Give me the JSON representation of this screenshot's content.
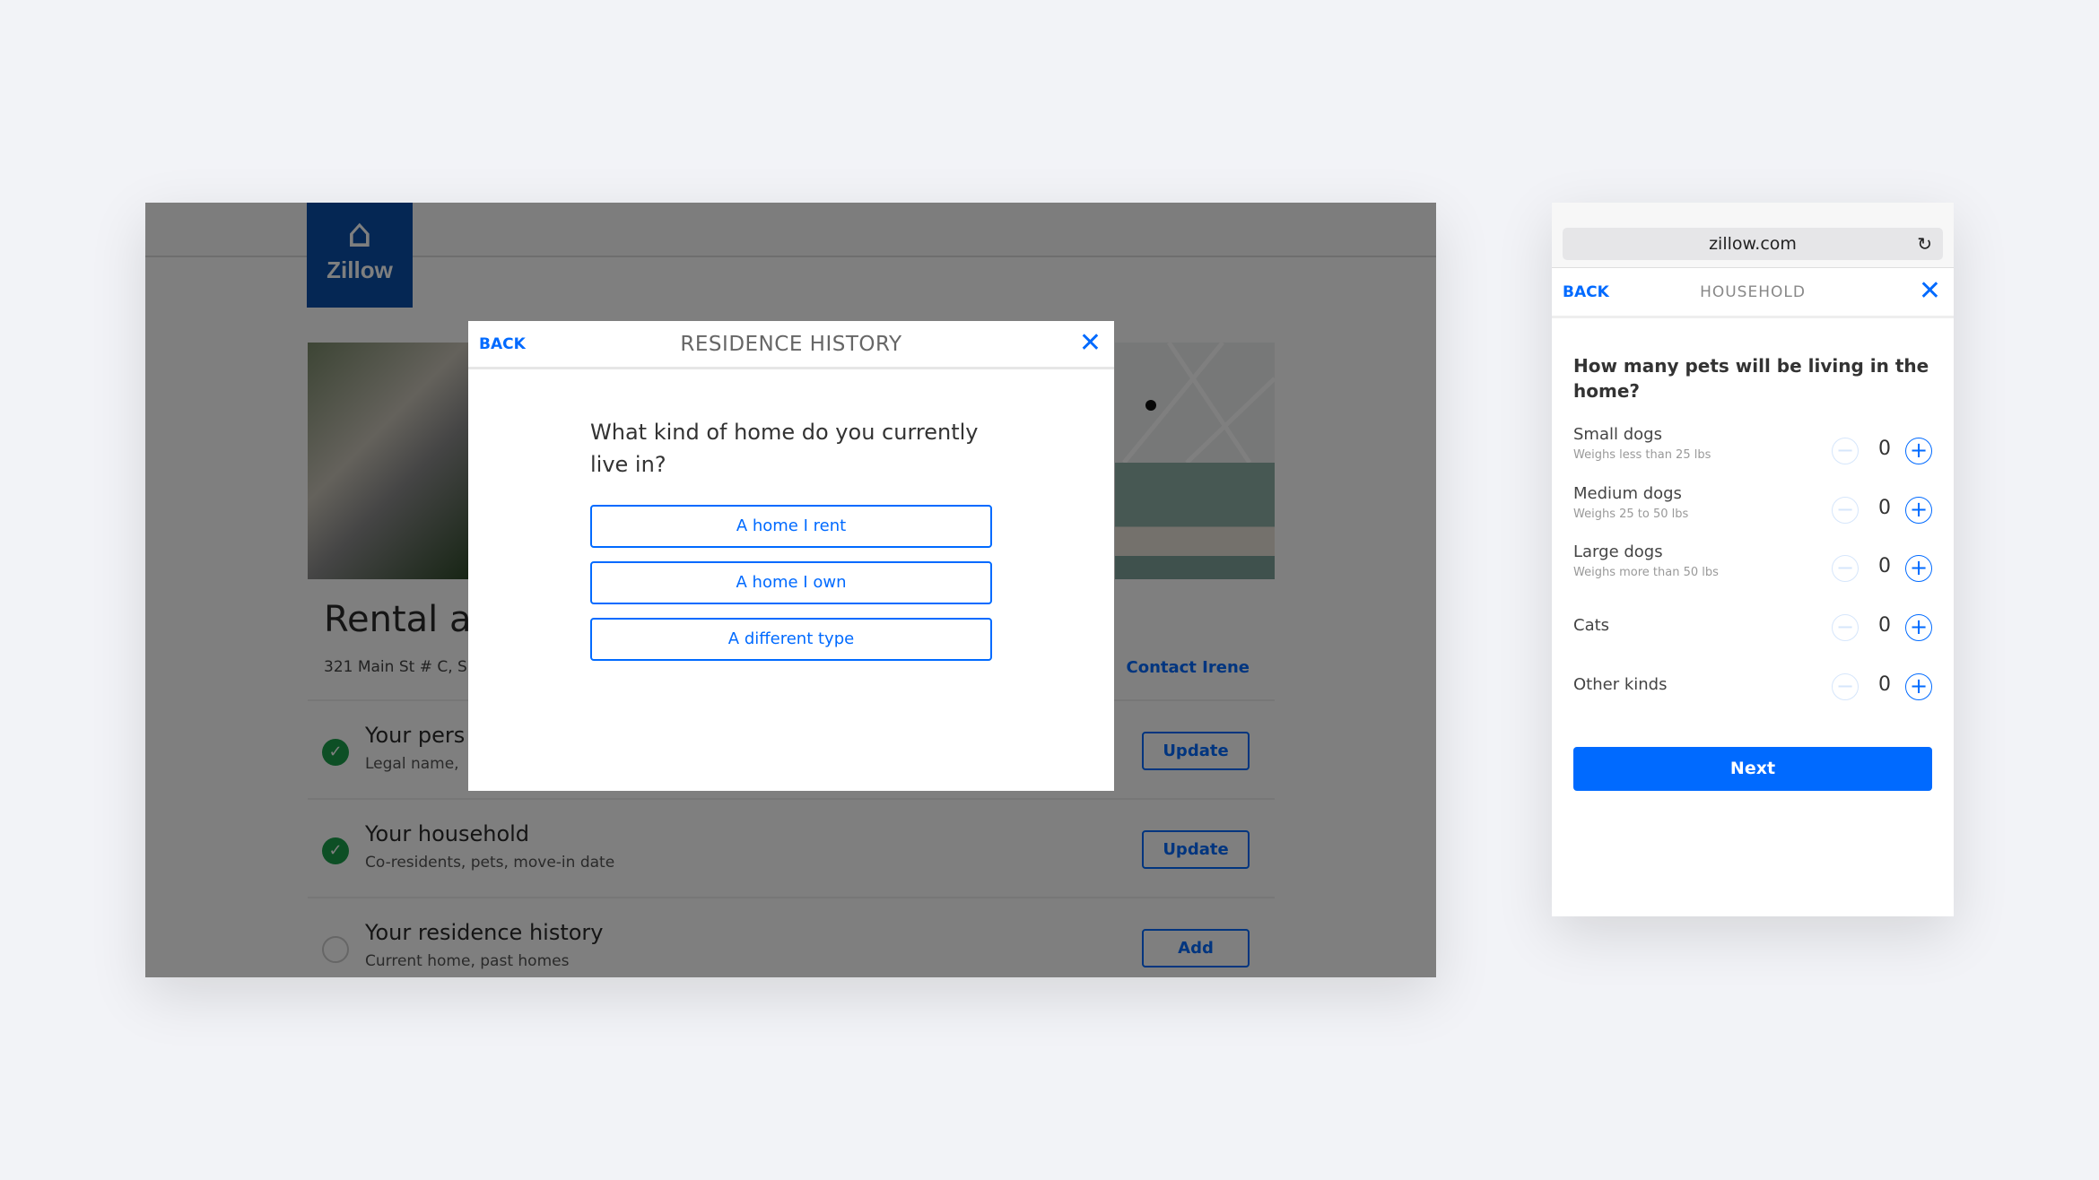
{
  "desktop": {
    "logo_text": "Zillow",
    "title": "Rental a",
    "address": "321 Main St # C, S",
    "contact": "Contact Irene",
    "rows": [
      {
        "title": "Your pers",
        "sub": "Legal name,",
        "button": "Update",
        "done": true
      },
      {
        "title": "Your household",
        "sub": "Co-residents, pets, move-in date",
        "button": "Update",
        "done": true
      },
      {
        "title": "Your residence history",
        "sub": "Current home, past homes",
        "button": "Add",
        "done": false
      }
    ],
    "modal": {
      "back": "BACK",
      "title": "RESIDENCE HISTORY",
      "question": "What kind of home do you currently live in?",
      "options": [
        "A home I rent",
        "A home I own",
        "A different type"
      ]
    }
  },
  "mobile": {
    "url": "zillow.com",
    "back": "BACK",
    "title": "HOUSEHOLD",
    "question": "How many pets will be living in the home?",
    "pets": [
      {
        "label": "Small dogs",
        "sub": "Weighs less than 25 lbs",
        "value": "0"
      },
      {
        "label": "Medium dogs",
        "sub": "Weighs 25 to 50 lbs",
        "value": "0"
      },
      {
        "label": "Large dogs",
        "sub": "Weighs more than 50 lbs",
        "value": "0"
      },
      {
        "label": "Cats",
        "sub": "",
        "value": "0"
      },
      {
        "label": "Other kinds",
        "sub": "",
        "value": "0"
      }
    ],
    "next": "Next"
  },
  "colors": {
    "accent": "#006aff",
    "brand": "#0a4fa8",
    "success": "#1a9e4a"
  }
}
